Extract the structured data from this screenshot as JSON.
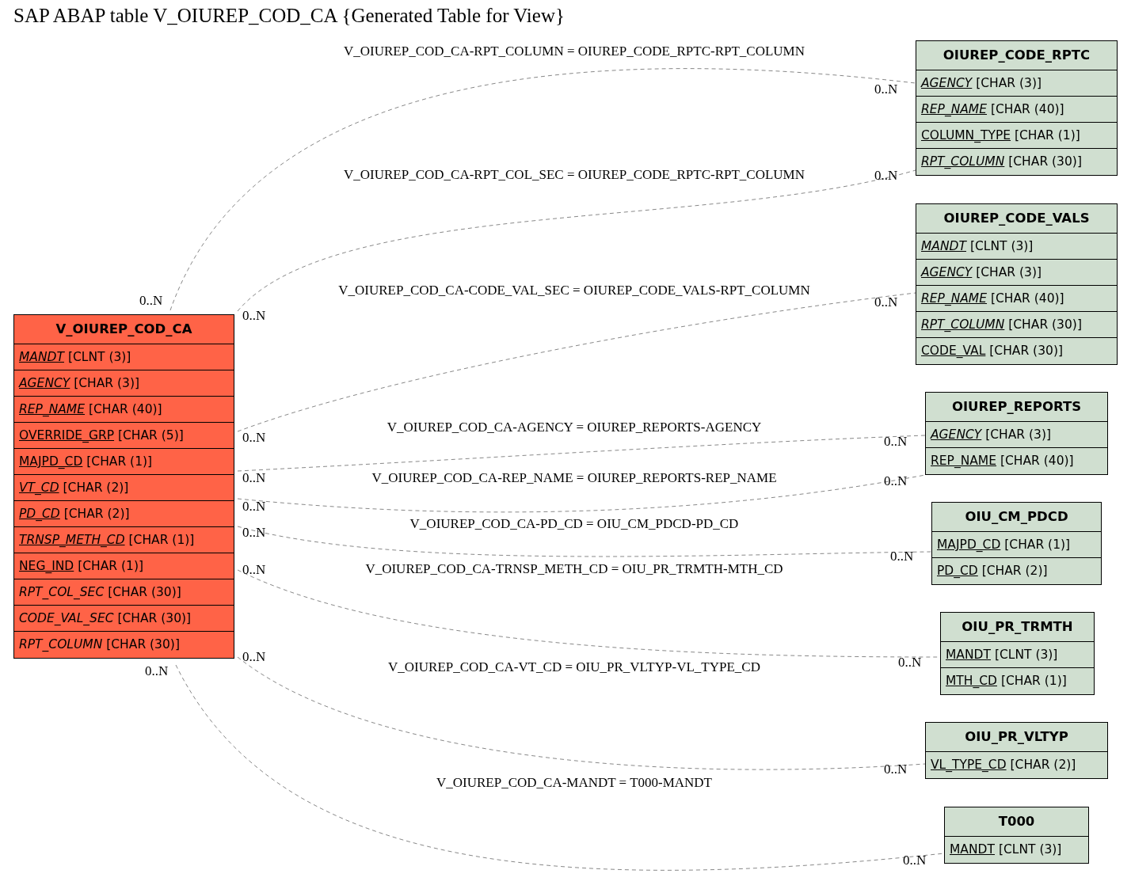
{
  "title": "SAP ABAP table V_OIUREP_COD_CA {Generated Table for View}",
  "main_table": {
    "name": "V_OIUREP_COD_CA",
    "fields": [
      {
        "name": "MANDT",
        "type": "[CLNT (3)]",
        "key": true,
        "italic": true
      },
      {
        "name": "AGENCY",
        "type": "[CHAR (3)]",
        "key": true,
        "italic": true
      },
      {
        "name": "REP_NAME",
        "type": "[CHAR (40)]",
        "key": true,
        "italic": true
      },
      {
        "name": "OVERRIDE_GRP",
        "type": "[CHAR (5)]",
        "key": true,
        "italic": false
      },
      {
        "name": "MAJPD_CD",
        "type": "[CHAR (1)]",
        "key": true,
        "italic": false
      },
      {
        "name": "VT_CD",
        "type": "[CHAR (2)]",
        "key": true,
        "italic": true
      },
      {
        "name": "PD_CD",
        "type": "[CHAR (2)]",
        "key": true,
        "italic": true
      },
      {
        "name": "TRNSP_METH_CD",
        "type": "[CHAR (1)]",
        "key": true,
        "italic": true
      },
      {
        "name": "NEG_IND",
        "type": "[CHAR (1)]",
        "key": true,
        "italic": false
      },
      {
        "name": "RPT_COL_SEC",
        "type": "[CHAR (30)]",
        "key": false,
        "italic": true
      },
      {
        "name": "CODE_VAL_SEC",
        "type": "[CHAR (30)]",
        "key": false,
        "italic": true
      },
      {
        "name": "RPT_COLUMN",
        "type": "[CHAR (30)]",
        "key": false,
        "italic": true
      }
    ]
  },
  "tables": [
    {
      "name": "OIUREP_CODE_RPTC",
      "fields": [
        {
          "name": "AGENCY",
          "type": "[CHAR (3)]",
          "key": true,
          "italic": true
        },
        {
          "name": "REP_NAME",
          "type": "[CHAR (40)]",
          "key": true,
          "italic": true
        },
        {
          "name": "COLUMN_TYPE",
          "type": "[CHAR (1)]",
          "key": true,
          "italic": false
        },
        {
          "name": "RPT_COLUMN",
          "type": "[CHAR (30)]",
          "key": true,
          "italic": true
        }
      ]
    },
    {
      "name": "OIUREP_CODE_VALS",
      "fields": [
        {
          "name": "MANDT",
          "type": "[CLNT (3)]",
          "key": true,
          "italic": true
        },
        {
          "name": "AGENCY",
          "type": "[CHAR (3)]",
          "key": true,
          "italic": true
        },
        {
          "name": "REP_NAME",
          "type": "[CHAR (40)]",
          "key": true,
          "italic": true
        },
        {
          "name": "RPT_COLUMN",
          "type": "[CHAR (30)]",
          "key": true,
          "italic": true
        },
        {
          "name": "CODE_VAL",
          "type": "[CHAR (30)]",
          "key": true,
          "italic": false
        }
      ]
    },
    {
      "name": "OIUREP_REPORTS",
      "fields": [
        {
          "name": "AGENCY",
          "type": "[CHAR (3)]",
          "key": true,
          "italic": true
        },
        {
          "name": "REP_NAME",
          "type": "[CHAR (40)]",
          "key": true,
          "italic": false
        }
      ]
    },
    {
      "name": "OIU_CM_PDCD",
      "fields": [
        {
          "name": "MAJPD_CD",
          "type": "[CHAR (1)]",
          "key": true,
          "italic": false
        },
        {
          "name": "PD_CD",
          "type": "[CHAR (2)]",
          "key": true,
          "italic": false
        }
      ]
    },
    {
      "name": "OIU_PR_TRMTH",
      "fields": [
        {
          "name": "MANDT",
          "type": "[CLNT (3)]",
          "key": true,
          "italic": false
        },
        {
          "name": "MTH_CD",
          "type": "[CHAR (1)]",
          "key": true,
          "italic": false
        }
      ]
    },
    {
      "name": "OIU_PR_VLTYP",
      "fields": [
        {
          "name": "VL_TYPE_CD",
          "type": "[CHAR (2)]",
          "key": true,
          "italic": false
        }
      ]
    },
    {
      "name": "T000",
      "fields": [
        {
          "name": "MANDT",
          "type": "[CLNT (3)]",
          "key": true,
          "italic": false
        }
      ]
    }
  ],
  "relations": [
    {
      "label": "V_OIUREP_COD_CA-RPT_COLUMN = OIUREP_CODE_RPTC-RPT_COLUMN",
      "left_cardinality": "0..N",
      "right_cardinality": "0..N"
    },
    {
      "label": "V_OIUREP_COD_CA-RPT_COL_SEC = OIUREP_CODE_RPTC-RPT_COLUMN",
      "left_cardinality": "0..N",
      "right_cardinality": "0..N"
    },
    {
      "label": "V_OIUREP_COD_CA-CODE_VAL_SEC = OIUREP_CODE_VALS-RPT_COLUMN",
      "left_cardinality": "0..N",
      "right_cardinality": "0..N"
    },
    {
      "label": "V_OIUREP_COD_CA-AGENCY = OIUREP_REPORTS-AGENCY",
      "left_cardinality": "0..N",
      "right_cardinality": "0..N"
    },
    {
      "label": "V_OIUREP_COD_CA-REP_NAME = OIUREP_REPORTS-REP_NAME",
      "left_cardinality": "0..N",
      "right_cardinality": "0..N"
    },
    {
      "label": "V_OIUREP_COD_CA-PD_CD = OIU_CM_PDCD-PD_CD",
      "left_cardinality": "0..N",
      "right_cardinality": "0..N"
    },
    {
      "label": "V_OIUREP_COD_CA-TRNSP_METH_CD = OIU_PR_TRMTH-MTH_CD",
      "left_cardinality": "0..N",
      "right_cardinality": "0..N"
    },
    {
      "label": "V_OIUREP_COD_CA-VT_CD = OIU_PR_VLTYP-VL_TYPE_CD",
      "left_cardinality": "0..N",
      "right_cardinality": "0..N"
    },
    {
      "label": "V_OIUREP_COD_CA-MANDT = T000-MANDT",
      "left_cardinality": "0..N",
      "right_cardinality": "0..N"
    }
  ]
}
